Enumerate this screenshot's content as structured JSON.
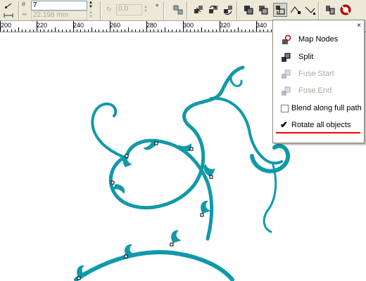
{
  "toolbar": {
    "steps_value": "7",
    "spacing_value": "22.198 mm",
    "rotation_value": "0,0",
    "degree_symbol": "°"
  },
  "ruler": {
    "labels": [
      "200",
      "220",
      "240",
      "260",
      "280",
      "300",
      "320",
      "340"
    ]
  },
  "menu": {
    "close_glyph": "×",
    "items": [
      {
        "label": "Map Nodes",
        "icon": "map-nodes-icon",
        "enabled": true
      },
      {
        "label": "Split",
        "icon": "split-icon",
        "enabled": true
      },
      {
        "label": "Fuse Start",
        "icon": "fuse-start-icon",
        "enabled": false
      },
      {
        "label": "Fuse End",
        "icon": "fuse-end-icon",
        "enabled": false
      },
      {
        "label": "Blend along full path",
        "checked": false
      },
      {
        "label": "Rotate all objects",
        "checked": true
      }
    ]
  },
  "colors": {
    "artwork": "#1199aa",
    "highlight_underline": "#ff0000",
    "toolbar_bg": "#ece9d8"
  }
}
